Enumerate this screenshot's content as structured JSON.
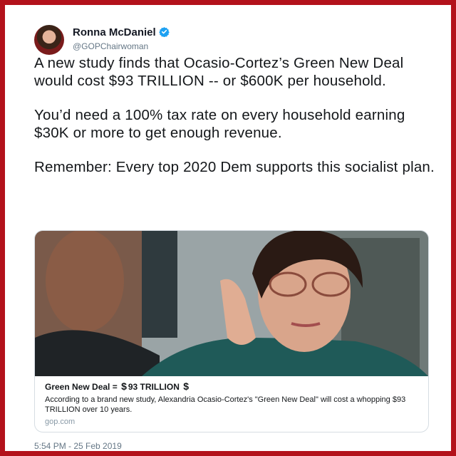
{
  "author": {
    "display_name": "Ronna McDaniel",
    "handle": "@GOPChairwoman",
    "verified": true
  },
  "tweet": {
    "paragraphs": [
      "A new study finds that Ocasio-Cortez’s Green New Deal would cost $93 TRILLION -- or $600K per household.",
      "You’d need a 100% tax rate on every household earning $30K or more to get enough revenue.",
      "Remember: Every top 2020 Dem supports this socialist plan."
    ],
    "timestamp": "5:54 PM - 25 Feb 2019"
  },
  "link_card": {
    "title_prefix": "Green New Deal =",
    "title_mark_1": "$",
    "title_amount": "93 TRILLION",
    "title_mark_2": "$",
    "description": "According to a brand new study, Alexandria Ocasio-Cortez's \"Green New Deal\" will cost a whopping $93 TRILLION over 10 years.",
    "domain": "gop.com"
  },
  "colors": {
    "frame_border": "#b3121b",
    "verified_badge": "#1da1f2",
    "secondary_text": "#657786"
  },
  "icons": {
    "verified": "verified-badge-icon"
  }
}
